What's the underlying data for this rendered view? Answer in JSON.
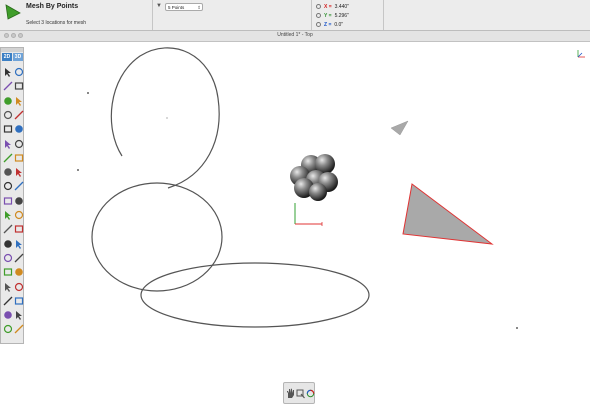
{
  "tool": {
    "title": "Mesh By Points",
    "prompt": "Select 3 locations for mesh",
    "icon": "triangle-mesh-icon",
    "accent": "#3f9d2a"
  },
  "mode_bar": {
    "points_value": "5 Points"
  },
  "coords": {
    "x_label": "X =",
    "x_value": "3.440\"",
    "y_label": "Y =",
    "y_value": "5.296\"",
    "z_label": "Z =",
    "z_value": "0.0\"",
    "x_color": "#d21c1c",
    "y_color": "#2f8f2f",
    "z_color": "#1d56c9"
  },
  "window": {
    "title": "Untitled 1* - Top"
  },
  "palette": {
    "tab_2d": "2D",
    "tab_3d": "3D",
    "tab_color": "#3b7fc4",
    "tools": [
      "pointer-icon",
      "pointer-alt-icon",
      "point-icon",
      "line-icon",
      "arc-icon",
      "circle-icon",
      "curve-icon",
      "spline-icon",
      "rectangle-icon",
      "polygon-icon",
      "offset-icon",
      "trim-icon",
      "text-icon",
      "annotate-icon",
      "dimension-icon",
      "hatch-icon",
      "copy-icon",
      "array-icon",
      "mirror-icon",
      "sphere-icon",
      "move-icon",
      "rotate-icon",
      "scale-icon",
      "boolean-icon",
      "transform-icon",
      "solid-icon",
      "surface-icon",
      "mesh-icon",
      "render-icon",
      "light-icon",
      "view-icon",
      "camera-icon",
      "pan-icon",
      "zoom-icon",
      "orbit-icon",
      "fit-icon",
      "display-icon",
      "layer-icon"
    ]
  },
  "bottom_palette": {
    "tools": [
      "hand-pan-icon",
      "zoom-window-icon",
      "orbit-refresh-icon"
    ]
  },
  "scene": {
    "curve_color": "#555555",
    "triangle_fill": "#a9a9a9",
    "triangle_stroke": "#e03333",
    "axis_x_color": "#e03333",
    "axis_y_color": "#33a033"
  }
}
